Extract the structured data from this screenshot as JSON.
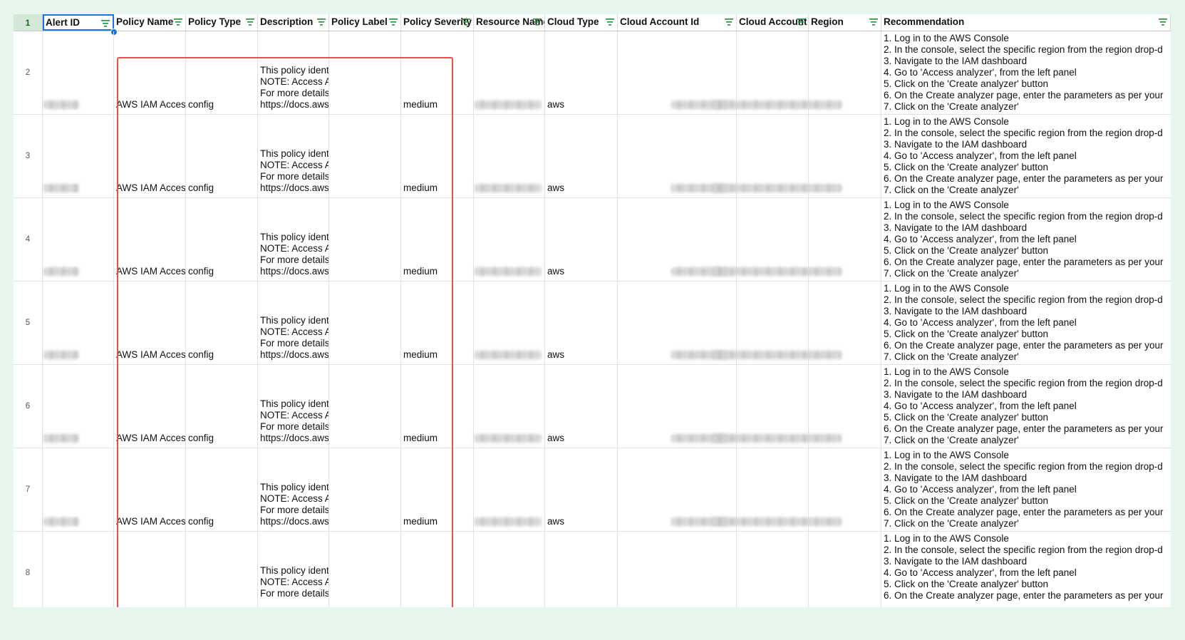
{
  "header": {
    "row_number": "1",
    "columns": [
      {
        "label": "Alert ID"
      },
      {
        "label": "Policy Name"
      },
      {
        "label": "Policy Type"
      },
      {
        "label": "Description"
      },
      {
        "label": "Policy Label"
      },
      {
        "label": "Policy Severity"
      },
      {
        "label": "Resource Name"
      },
      {
        "label": "Cloud Type"
      },
      {
        "label": "Cloud Account Id"
      },
      {
        "label": "Cloud Account Name"
      },
      {
        "label": "Region"
      },
      {
        "label": "Recommendation"
      }
    ]
  },
  "rows": [
    {
      "num": "2",
      "policy_name": "AWS IAM Acces",
      "policy_type": "config",
      "description": "This policy identifies AWS regions\nNOTE: Access Analyzer analyzes\nFor more details:\nhttps://docs.aws.amazon.com/IAM",
      "severity": "medium",
      "cloud_type": "aws",
      "recommendation": "1. Log in to the AWS Console\n2. In the console, select the specific region from the region drop-d\n3. Navigate to the IAM dashboard\n4. Go to 'Access analyzer', from the left panel\n5. Click on the 'Create analyzer' button\n6. On the Create analyzer page, enter the parameters as per your\n7. Click on the 'Create analyzer'"
    },
    {
      "num": "3",
      "policy_name": "AWS IAM Acces",
      "policy_type": "config",
      "description": "This policy identifies AWS regions\nNOTE: Access Analyzer analyzes\nFor more details:\nhttps://docs.aws.amazon.com/IAM",
      "severity": "medium",
      "cloud_type": "aws",
      "recommendation": "1. Log in to the AWS Console\n2. In the console, select the specific region from the region drop-d\n3. Navigate to the IAM dashboard\n4. Go to 'Access analyzer', from the left panel\n5. Click on the 'Create analyzer' button\n6. On the Create analyzer page, enter the parameters as per your\n7. Click on the 'Create analyzer'"
    },
    {
      "num": "4",
      "policy_name": "AWS IAM Acces",
      "policy_type": "config",
      "description": "This policy identifies AWS regions\nNOTE: Access Analyzer analyzes\nFor more details:\nhttps://docs.aws.amazon.com/IAM",
      "severity": "medium",
      "cloud_type": "aws",
      "recommendation": "1. Log in to the AWS Console\n2. In the console, select the specific region from the region drop-d\n3. Navigate to the IAM dashboard\n4. Go to 'Access analyzer', from the left panel\n5. Click on the 'Create analyzer' button\n6. On the Create analyzer page, enter the parameters as per your\n7. Click on the 'Create analyzer'"
    },
    {
      "num": "5",
      "policy_name": "AWS IAM Acces",
      "policy_type": "config",
      "description": "This policy identifies AWS regions\nNOTE: Access Analyzer analyzes\nFor more details:\nhttps://docs.aws.amazon.com/IAM",
      "severity": "medium",
      "cloud_type": "aws",
      "recommendation": "1. Log in to the AWS Console\n2. In the console, select the specific region from the region drop-d\n3. Navigate to the IAM dashboard\n4. Go to 'Access analyzer', from the left panel\n5. Click on the 'Create analyzer' button\n6. On the Create analyzer page, enter the parameters as per your\n7. Click on the 'Create analyzer'"
    },
    {
      "num": "6",
      "policy_name": "AWS IAM Acces",
      "policy_type": "config",
      "description": "This policy identifies AWS regions\nNOTE: Access Analyzer analyzes\nFor more details:\nhttps://docs.aws.amazon.com/IAM",
      "severity": "medium",
      "cloud_type": "aws",
      "recommendation": "1. Log in to the AWS Console\n2. In the console, select the specific region from the region drop-d\n3. Navigate to the IAM dashboard\n4. Go to 'Access analyzer', from the left panel\n5. Click on the 'Create analyzer' button\n6. On the Create analyzer page, enter the parameters as per your\n7. Click on the 'Create analyzer'"
    },
    {
      "num": "7",
      "policy_name": "AWS IAM Acces",
      "policy_type": "config",
      "description": "This policy identifies AWS regions\nNOTE: Access Analyzer analyzes\nFor more details:\nhttps://docs.aws.amazon.com/IAM",
      "severity": "medium",
      "cloud_type": "aws",
      "recommendation": "1. Log in to the AWS Console\n2. In the console, select the specific region from the region drop-d\n3. Navigate to the IAM dashboard\n4. Go to 'Access analyzer', from the left panel\n5. Click on the 'Create analyzer' button\n6. On the Create analyzer page, enter the parameters as per your\n7. Click on the 'Create analyzer'"
    },
    {
      "num": "8",
      "policy_name": "",
      "policy_type": "",
      "description": "This policy identifies AWS regions\nNOTE: Access Analyzer analyzes\nFor more details:",
      "severity": "",
      "cloud_type": "",
      "recommendation": "1. Log in to the AWS Console\n2. In the console, select the specific region from the region drop-d\n3. Navigate to the IAM dashboard\n4. Go to 'Access analyzer', from the left panel\n5. Click on the 'Create analyzer' button\n6. On the Create analyzer page, enter the parameters as per your"
    }
  ],
  "icons": {
    "filter": "filter-icon"
  },
  "colors": {
    "highlight_box": "#e8524a",
    "selection": "#1a73e8",
    "header_number_bg": "#d3e9d8",
    "filter_icon": "#1e8e3e"
  }
}
